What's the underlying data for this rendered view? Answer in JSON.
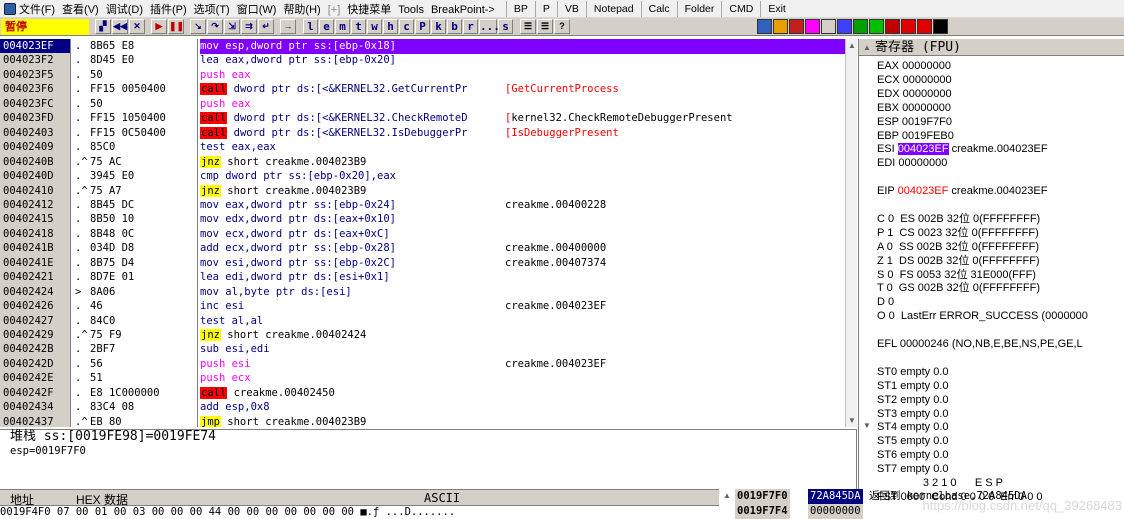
{
  "menu": {
    "items": [
      "文件(F)",
      "查看(V)",
      "调试(D)",
      "插件(P)",
      "选项(T)",
      "窗口(W)",
      "帮助(H)",
      "[+]",
      "快捷菜单",
      "Tools",
      "BreakPoint->"
    ],
    "tabs": [
      "BP",
      "P",
      "VB",
      "Notepad",
      "Calc",
      "Folder",
      "CMD",
      "Exit"
    ]
  },
  "toolbar": {
    "status": "暂停",
    "buttons": [
      "open-icon",
      "rewind-icon",
      "close-icon",
      "run-icon",
      "pause-icon",
      "step-into-icon",
      "step-over-icon",
      "trace-into-icon",
      "trace-over-icon",
      "execute-till-return-icon",
      "go-to-icon"
    ],
    "letters": [
      "l",
      "e",
      "m",
      "t",
      "w",
      "h",
      "c",
      "P",
      "k",
      "b",
      "r",
      "...",
      "s"
    ],
    "extra": [
      "list-icon",
      "window-icon",
      "help-icon"
    ]
  },
  "disasm": {
    "rows": [
      {
        "addr": "004023EF",
        "mark": ".",
        "hex": "8B65 E8",
        "ins": "mov esp,dword ptr ss:[ebp-0x18]",
        "kind": "norm",
        "cmt": "",
        "sel": true
      },
      {
        "addr": "004023F2",
        "mark": ".",
        "hex": "8D45 E0",
        "ins": "lea eax,dword ptr ss:[ebp-0x20]",
        "kind": "norm",
        "cmt": ""
      },
      {
        "addr": "004023F5",
        "mark": ".",
        "hex": "50",
        "ins": "push eax",
        "kind": "push",
        "cmt": ""
      },
      {
        "addr": "004023F6",
        "mark": ".",
        "hex": "FF15 0050400",
        "ins": "call dword ptr ds:[<&KERNEL32.GetCurrentPr",
        "kind": "call",
        "cmt": "GetCurrentProcess",
        "cmtred": true
      },
      {
        "addr": "004023FC",
        "mark": ".",
        "hex": "50",
        "ins": "push eax",
        "kind": "push",
        "cmt": ""
      },
      {
        "addr": "004023FD",
        "mark": ".",
        "hex": "FF15 1050400",
        "ins": "call dword ptr ds:[<&KERNEL32.CheckRemoteD",
        "kind": "call",
        "cmt": "kernel32.CheckRemoteDebuggerPresent",
        "cmtred": false
      },
      {
        "addr": "00402403",
        "mark": ".",
        "hex": "FF15 0C50400",
        "ins": "call dword ptr ds:[<&KERNEL32.IsDebuggerPr",
        "kind": "call",
        "cmt": "IsDebuggerPresent",
        "cmtred": true
      },
      {
        "addr": "00402409",
        "mark": ".",
        "hex": "85C0",
        "ins": "test eax,eax",
        "kind": "norm",
        "cmt": ""
      },
      {
        "addr": "0040240B",
        "mark": ".^",
        "hex": "75 AC",
        "ins": "jnz short creakme.004023B9",
        "kind": "jmp",
        "cmt": ""
      },
      {
        "addr": "0040240D",
        "mark": ".",
        "hex": "3945 E0",
        "ins": "cmp dword ptr ss:[ebp-0x20],eax",
        "kind": "norm",
        "cmt": ""
      },
      {
        "addr": "00402410",
        "mark": ".^",
        "hex": "75 A7",
        "ins": "jnz short creakme.004023B9",
        "kind": "jmp",
        "cmt": ""
      },
      {
        "addr": "00402412",
        "mark": ".",
        "hex": "8B45 DC",
        "ins": "mov eax,dword ptr ss:[ebp-0x24]",
        "kind": "norm",
        "cmt": "creakme.00400228"
      },
      {
        "addr": "00402415",
        "mark": ".",
        "hex": "8B50 10",
        "ins": "mov edx,dword ptr ds:[eax+0x10]",
        "kind": "norm",
        "cmt": ""
      },
      {
        "addr": "00402418",
        "mark": ".",
        "hex": "8B48 0C",
        "ins": "mov ecx,dword ptr ds:[eax+0xC]",
        "kind": "norm",
        "cmt": ""
      },
      {
        "addr": "0040241B",
        "mark": ".",
        "hex": "034D D8",
        "ins": "add ecx,dword ptr ss:[ebp-0x28]",
        "kind": "norm",
        "cmt": "creakme.00400000"
      },
      {
        "addr": "0040241E",
        "mark": ".",
        "hex": "8B75 D4",
        "ins": "mov esi,dword ptr ss:[ebp-0x2C]",
        "kind": "norm",
        "cmt": "creakme.00407374"
      },
      {
        "addr": "00402421",
        "mark": ".",
        "hex": "8D7E 01",
        "ins": "lea edi,dword ptr ds:[esi+0x1]",
        "kind": "norm",
        "cmt": ""
      },
      {
        "addr": "00402424",
        "mark": ">",
        "hex": "8A06",
        "ins": "mov al,byte ptr ds:[esi]",
        "kind": "norm",
        "cmt": ""
      },
      {
        "addr": "00402426",
        "mark": ".",
        "hex": "46",
        "ins": "inc esi",
        "kind": "norm",
        "cmt": "creakme.004023EF"
      },
      {
        "addr": "00402427",
        "mark": ".",
        "hex": "84C0",
        "ins": "test al,al",
        "kind": "norm",
        "cmt": ""
      },
      {
        "addr": "00402429",
        "mark": ".^",
        "hex": "75 F9",
        "ins": "jnz short creakme.00402424",
        "kind": "jmp",
        "cmt": ""
      },
      {
        "addr": "0040242B",
        "mark": ".",
        "hex": "2BF7",
        "ins": "sub esi,edi",
        "kind": "norm",
        "cmt": ""
      },
      {
        "addr": "0040242D",
        "mark": ".",
        "hex": "56",
        "ins": "push esi",
        "kind": "push",
        "cmt": "creakme.004023EF"
      },
      {
        "addr": "0040242E",
        "mark": ".",
        "hex": "51",
        "ins": "push ecx",
        "kind": "push",
        "cmt": ""
      },
      {
        "addr": "0040242F",
        "mark": ".",
        "hex": "E8 1C000000",
        "ins": "call creakme.00402450",
        "kind": "call",
        "cmt": ""
      },
      {
        "addr": "00402434",
        "mark": ".",
        "hex": "83C4 08",
        "ins": "add esp,0x8",
        "kind": "norm",
        "cmt": ""
      },
      {
        "addr": "00402437",
        "mark": ".^",
        "hex": "EB 80",
        "ins": "jmp short creakme.004023B9",
        "kind": "jmp",
        "cmt": ""
      }
    ]
  },
  "info": {
    "line1": "堆栈 ss:[0019FE98]=0019FE74",
    "line2": "esp=0019F7F0"
  },
  "dump": {
    "col_addr": "地址",
    "col_hex": "HEX 数据",
    "col_ascii": "ASCII",
    "row": "0019F4F0 07 00 01 00 03 00 00 00 44 00 00 00 00 00 00 00 ■.ƒ ...D......."
  },
  "stack": {
    "rows": [
      {
        "addr": "0019F7F0",
        "val": "72A845DA",
        "cmt": "返回到 kernelbase.72A845DA"
      },
      {
        "addr": "0019F7F4",
        "val": "00000000",
        "cmt": ""
      }
    ]
  },
  "regs": {
    "title": "寄存器 (FPU)",
    "lines": [
      {
        "t": "EAX 00000000"
      },
      {
        "t": "ECX 00000000"
      },
      {
        "t": "EDX 00000000"
      },
      {
        "t": "EBX 00000000"
      },
      {
        "t": "ESP 0019F7F0"
      },
      {
        "t": "EBP 0019FEB0"
      },
      {
        "pre": "ESI ",
        "hl": "004023EF",
        "post": " creakme.004023EF"
      },
      {
        "t": "EDI 00000000"
      },
      {
        "t": ""
      },
      {
        "pre": "EIP ",
        "red": "004023EF",
        "post": " creakme.004023EF"
      },
      {
        "t": ""
      },
      {
        "t": "C 0  ES 002B 32位 0(FFFFFFFF)"
      },
      {
        "t": "P 1  CS 0023 32位 0(FFFFFFFF)"
      },
      {
        "t": "A 0  SS 002B 32位 0(FFFFFFFF)"
      },
      {
        "t": "Z 1  DS 002B 32位 0(FFFFFFFF)"
      },
      {
        "t": "S 0  FS 0053 32位 31E000(FFF)"
      },
      {
        "t": "T 0  GS 002B 32位 0(FFFFFFFF)"
      },
      {
        "t": "D 0"
      },
      {
        "t": "O 0  LastErr ERROR_SUCCESS (0000000"
      },
      {
        "t": ""
      },
      {
        "t": "EFL 00000246 (NO,NB,E,BE,NS,PE,GE,L"
      },
      {
        "t": ""
      },
      {
        "t": "ST0 empty 0.0"
      },
      {
        "t": "ST1 empty 0.0"
      },
      {
        "t": "ST2 empty 0.0"
      },
      {
        "t": "ST3 empty 0.0"
      },
      {
        "t": "ST4 empty 0.0"
      },
      {
        "t": "ST5 empty 0.0"
      },
      {
        "t": "ST6 empty 0.0"
      },
      {
        "t": "ST7 empty 0.0"
      },
      {
        "t": "               3 2 1 0      E S P"
      },
      {
        "t": "FST 0000  Cond 0 0 0 0  Err 0 0 0"
      }
    ]
  },
  "watermark": "https://blog.csdn.net/qq_39268483",
  "colors": {
    "selection": "#8000ff",
    "call": "#ff0000",
    "jump": "#ffff00",
    "push": "#ff00ff",
    "navy": "#000080"
  }
}
